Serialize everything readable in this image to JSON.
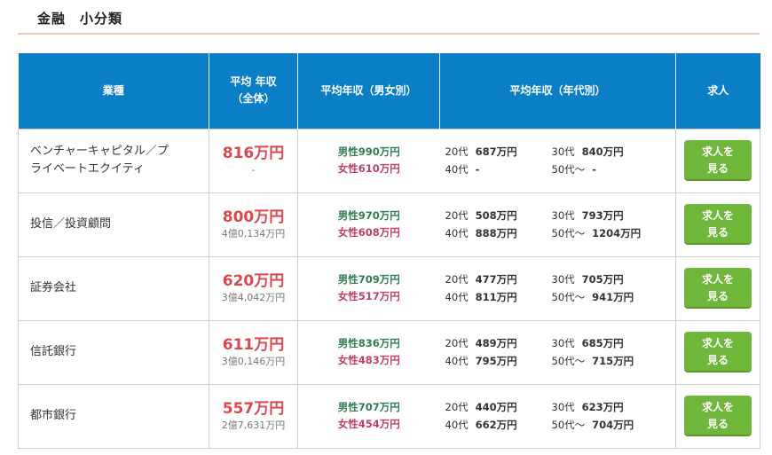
{
  "section": {
    "title": "金融　小分類"
  },
  "table": {
    "headers": {
      "industry": "業種",
      "avg_line1": "平均 年収",
      "avg_line2": "（全体）",
      "gender": "平均年収（男女別）",
      "age": "平均年収（年代別）",
      "jobs": "求人"
    },
    "rows": [
      {
        "industry_line1": "ベンチャーキャピタル／プ",
        "industry_line2": "ライベートエクイティ",
        "avg": "816万円",
        "avg_sub": "-",
        "male": "男性990万円",
        "female": "女性610万円",
        "age20_label": "20代",
        "age20": "687万円",
        "age30_label": "30代",
        "age30": "840万円",
        "age40_label": "40代",
        "age40": "-",
        "age50_label": "50代〜",
        "age50": "-",
        "button_line1": "求人を",
        "button_line2": "見る"
      },
      {
        "industry_line1": "投信／投資顧問",
        "industry_line2": "",
        "avg": "800万円",
        "avg_sub": "4億0,134万円",
        "male": "男性970万円",
        "female": "女性608万円",
        "age20_label": "20代",
        "age20": "508万円",
        "age30_label": "30代",
        "age30": "793万円",
        "age40_label": "40代",
        "age40": "888万円",
        "age50_label": "50代〜",
        "age50": "1204万円",
        "button_line1": "求人を",
        "button_line2": "見る"
      },
      {
        "industry_line1": "証券会社",
        "industry_line2": "",
        "avg": "620万円",
        "avg_sub": "3億4,042万円",
        "male": "男性709万円",
        "female": "女性517万円",
        "age20_label": "20代",
        "age20": "477万円",
        "age30_label": "30代",
        "age30": "705万円",
        "age40_label": "40代",
        "age40": "811万円",
        "age50_label": "50代〜",
        "age50": "941万円",
        "button_line1": "求人を",
        "button_line2": "見る"
      },
      {
        "industry_line1": "信託銀行",
        "industry_line2": "",
        "avg": "611万円",
        "avg_sub": "3億0,146万円",
        "male": "男性836万円",
        "female": "女性483万円",
        "age20_label": "20代",
        "age20": "489万円",
        "age30_label": "30代",
        "age30": "685万円",
        "age40_label": "40代",
        "age40": "795万円",
        "age50_label": "50代〜",
        "age50": "715万円",
        "button_line1": "求人を",
        "button_line2": "見る"
      },
      {
        "industry_line1": "都市銀行",
        "industry_line2": "",
        "avg": "557万円",
        "avg_sub": "2億7,631万円",
        "male": "男性707万円",
        "female": "女性454万円",
        "age20_label": "20代",
        "age20": "440万円",
        "age30_label": "30代",
        "age30": "623万円",
        "age40_label": "40代",
        "age40": "662万円",
        "age50_label": "50代〜",
        "age50": "704万円",
        "button_line1": "求人を",
        "button_line2": "見る"
      }
    ]
  },
  "colors": {
    "header_bg": "#0a7fc5",
    "avg_red": "#d9484f",
    "male_green": "#2e7d4f",
    "female_pink": "#c0415f",
    "button_green": "#6fb73a"
  }
}
